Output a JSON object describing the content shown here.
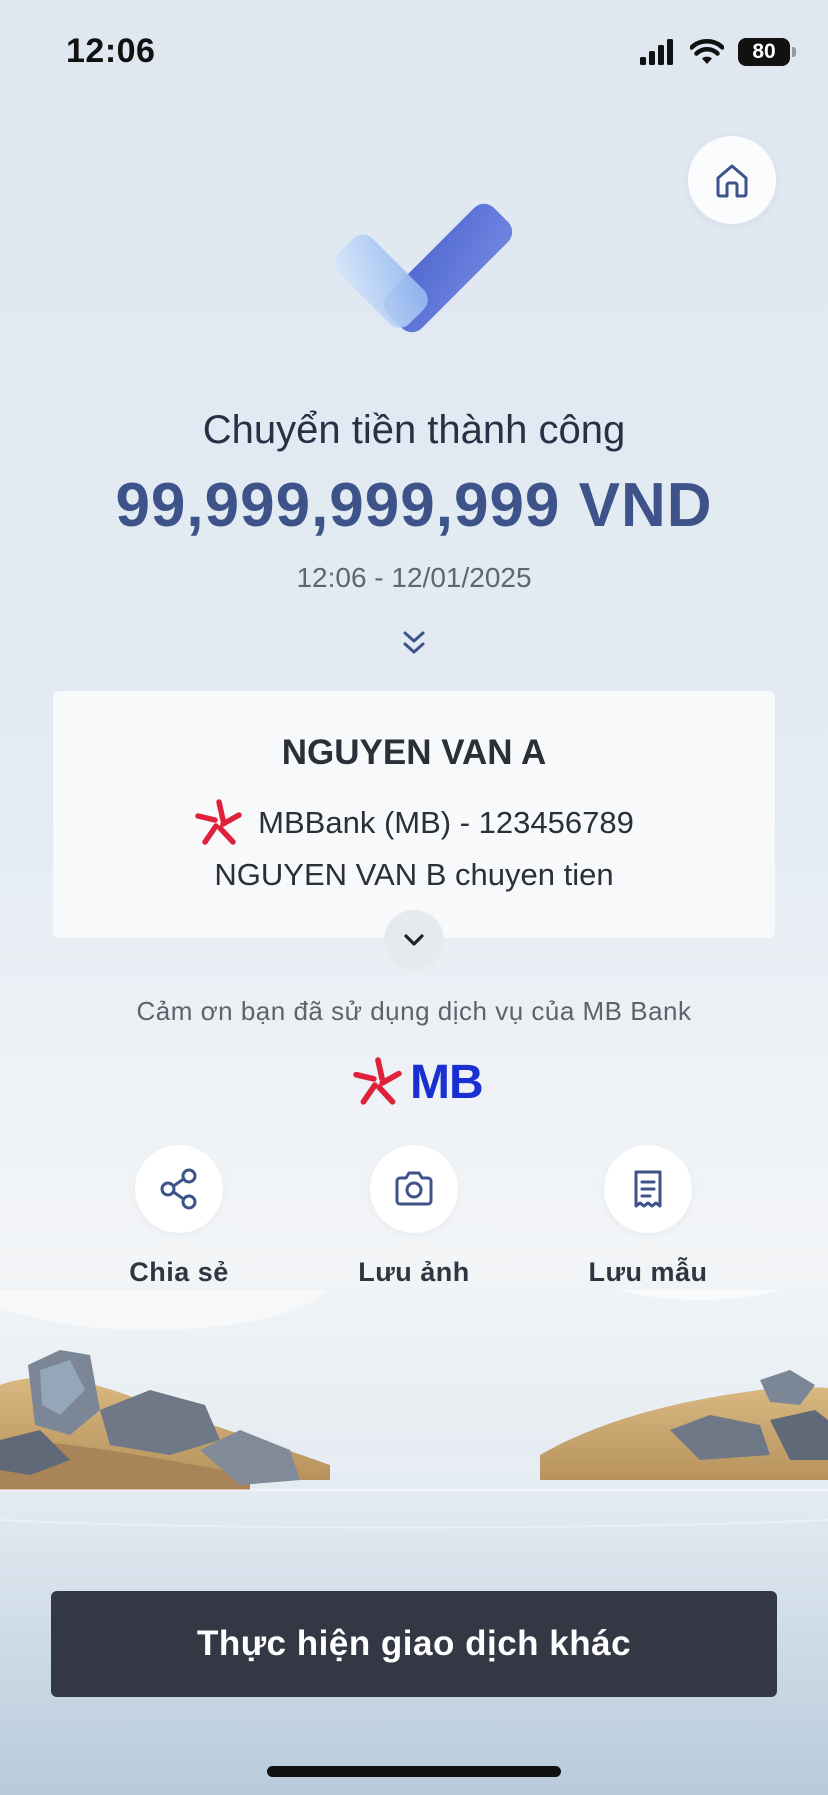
{
  "status_bar": {
    "time": "12:06",
    "battery": "80",
    "icons": [
      "signal-icon",
      "wifi-icon",
      "battery-icon"
    ]
  },
  "header": {
    "home_icon": "home-icon"
  },
  "result": {
    "title": "Chuyển tiền thành công",
    "amount": "99,999,999,999 VND",
    "datetime": "12:06 - 12/01/2025"
  },
  "recipient": {
    "name": "NGUYEN VAN A",
    "bank_account": "MBBank (MB) - 123456789",
    "note": "NGUYEN VAN B chuyen tien"
  },
  "footer": {
    "thanks": "Cảm ơn bạn đã sử dụng dịch vụ của MB Bank",
    "logo_text": "MB"
  },
  "actions": [
    {
      "label": "Chia sẻ",
      "icon": "share-icon"
    },
    {
      "label": "Lưu ảnh",
      "icon": "camera-icon"
    },
    {
      "label": "Lưu mẫu",
      "icon": "receipt-icon"
    }
  ],
  "primary_button": {
    "label": "Thực hiện giao dịch khác"
  },
  "colors": {
    "amount": "#3d5389",
    "primary_button": "#343845",
    "mb_blue": "#1a2fd0",
    "mb_red": "#e0213b"
  }
}
